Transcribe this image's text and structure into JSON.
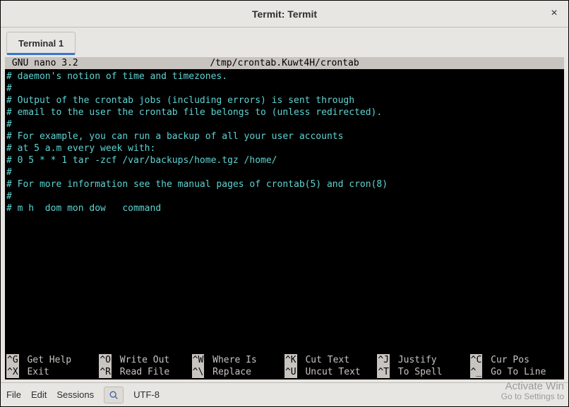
{
  "window": {
    "title": "Termit: Termit"
  },
  "tabs": [
    {
      "label": "Terminal 1",
      "active": true
    }
  ],
  "nano": {
    "header_left": " GNU nano 3.2",
    "header_center": "/tmp/crontab.Kuwt4H/crontab",
    "body_lines": [
      "# daemon's notion of time and timezones.",
      "#",
      "# Output of the crontab jobs (including errors) is sent through",
      "# email to the user the crontab file belongs to (unless redirected).",
      "#",
      "# For example, you can run a backup of all your user accounts",
      "# at 5 a.m every week with:",
      "# 0 5 * * 1 tar -zcf /var/backups/home.tgz /home/",
      "#",
      "# For more information see the manual pages of crontab(5) and cron(8)",
      "#",
      "# m h  dom mon dow   command"
    ],
    "footer": {
      "row1": [
        {
          "key": "^G",
          "label": "Get Help"
        },
        {
          "key": "^O",
          "label": "Write Out"
        },
        {
          "key": "^W",
          "label": "Where Is"
        },
        {
          "key": "^K",
          "label": "Cut Text"
        },
        {
          "key": "^J",
          "label": "Justify"
        },
        {
          "key": "^C",
          "label": "Cur Pos"
        }
      ],
      "row2": [
        {
          "key": "^X",
          "label": "Exit"
        },
        {
          "key": "^R",
          "label": "Read File"
        },
        {
          "key": "^\\",
          "label": "Replace"
        },
        {
          "key": "^U",
          "label": "Uncut Text"
        },
        {
          "key": "^T",
          "label": "To Spell"
        },
        {
          "key": "^_",
          "label": "Go To Line"
        }
      ]
    }
  },
  "statusbar": {
    "menu": [
      "File",
      "Edit",
      "Sessions"
    ],
    "encoding": "UTF-8"
  },
  "watermark": {
    "line1": "Activate Win",
    "line2": "Go to Settings to"
  }
}
